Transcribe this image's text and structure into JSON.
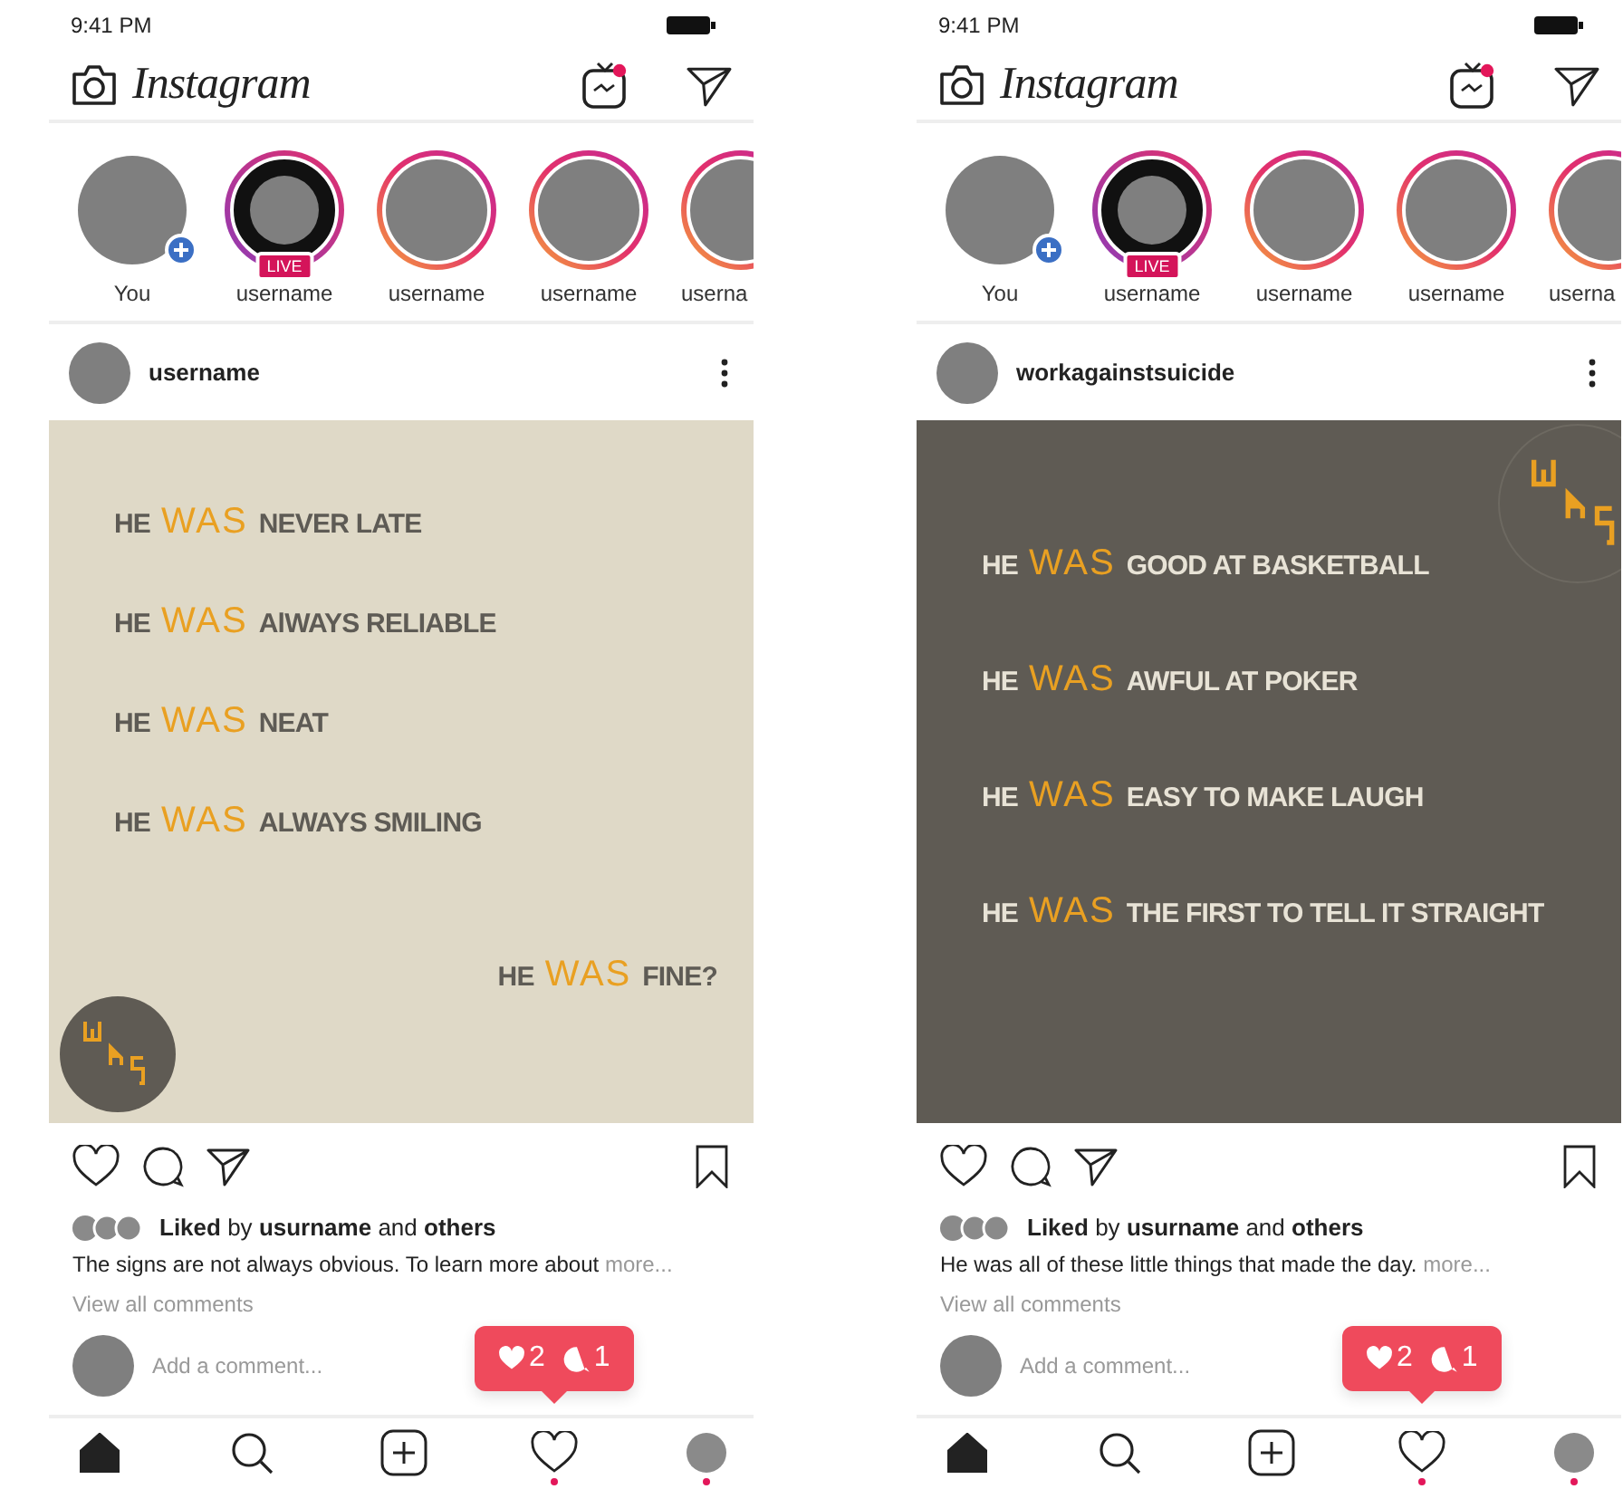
{
  "phones": [
    {
      "status": {
        "time": "9:41 PM"
      },
      "header": {
        "logo": "Instagram",
        "igtv_badge": true
      },
      "stories": [
        {
          "kind": "own",
          "name": "You"
        },
        {
          "kind": "live",
          "name": "username",
          "live_label": "LIVE"
        },
        {
          "kind": "story",
          "name": "username"
        },
        {
          "kind": "story",
          "name": "username"
        },
        {
          "kind": "story",
          "name": "userna"
        }
      ],
      "post": {
        "username": "username",
        "image": {
          "kind": "light",
          "lines": [
            {
              "kind": "statement",
              "prefix": "HE",
              "highlight": "WAS",
              "rest": "NEVER LATE"
            },
            {
              "kind": "statement",
              "prefix": "HE",
              "highlight": "WAS",
              "rest": "AlWAYS RELIABLE"
            },
            {
              "kind": "statement",
              "prefix": "HE",
              "highlight": "WAS",
              "rest": "NEAT"
            },
            {
              "kind": "statement",
              "prefix": "HE",
              "highlight": "WAS",
              "rest": "ALWAYS SMILING"
            },
            {
              "kind": "question",
              "prefix": "HE",
              "highlight": "WAS",
              "rest": "FINE?"
            }
          ]
        },
        "likes": "**Liked** by **usurname** and **others**",
        "caption": "The signs are not always obvious. To learn more about",
        "more": "more...",
        "view_comments": "View all comments",
        "comment_placeholder": "Add a comment..."
      },
      "toast": {
        "likes": "2",
        "comments": "1"
      },
      "nav": [
        {
          "kind": "home",
          "selected": true,
          "badge": false
        },
        {
          "kind": "search",
          "selected": false,
          "badge": false
        },
        {
          "kind": "add",
          "selected": false,
          "badge": false
        },
        {
          "kind": "activity",
          "selected": false,
          "badge": true
        },
        {
          "kind": "profile",
          "selected": false,
          "badge": true
        }
      ]
    },
    {
      "status": {
        "time": "9:41 PM"
      },
      "header": {
        "logo": "Instagram",
        "igtv_badge": true
      },
      "stories": [
        {
          "kind": "own",
          "name": "You"
        },
        {
          "kind": "live",
          "name": "username",
          "live_label": "LIVE"
        },
        {
          "kind": "story",
          "name": "username"
        },
        {
          "kind": "story",
          "name": "username"
        },
        {
          "kind": "story",
          "name": "userna"
        }
      ],
      "post": {
        "username": "workagainstsuicide",
        "image": {
          "kind": "dark",
          "lines": [
            {
              "kind": "statement",
              "prefix": "HE",
              "highlight": "WAS",
              "rest": "GOOD AT BASKETBALL"
            },
            {
              "kind": "statement",
              "prefix": "HE",
              "highlight": "WAS",
              "rest": "AWFUL AT POKER"
            },
            {
              "kind": "statement",
              "prefix": "HE",
              "highlight": "WAS",
              "rest": "EASY TO MAKE LAUGH"
            },
            {
              "kind": "statement",
              "prefix": "HE",
              "highlight": "WAS",
              "rest": "THE FIRST TO TELL IT STRAIGHT"
            }
          ]
        },
        "likes": "**Liked** by **usurname** and **others**",
        "caption": "He was all of these little things that made the day.",
        "more": "more...",
        "view_comments": "View all comments",
        "comment_placeholder": "Add a comment..."
      },
      "toast": {
        "likes": "2",
        "comments": "1"
      },
      "nav": [
        {
          "kind": "home",
          "selected": true,
          "badge": false
        },
        {
          "kind": "search",
          "selected": false,
          "badge": false
        },
        {
          "kind": "add",
          "selected": false,
          "badge": false
        },
        {
          "kind": "activity",
          "selected": false,
          "badge": true
        },
        {
          "kind": "profile",
          "selected": false,
          "badge": true
        }
      ]
    }
  ]
}
